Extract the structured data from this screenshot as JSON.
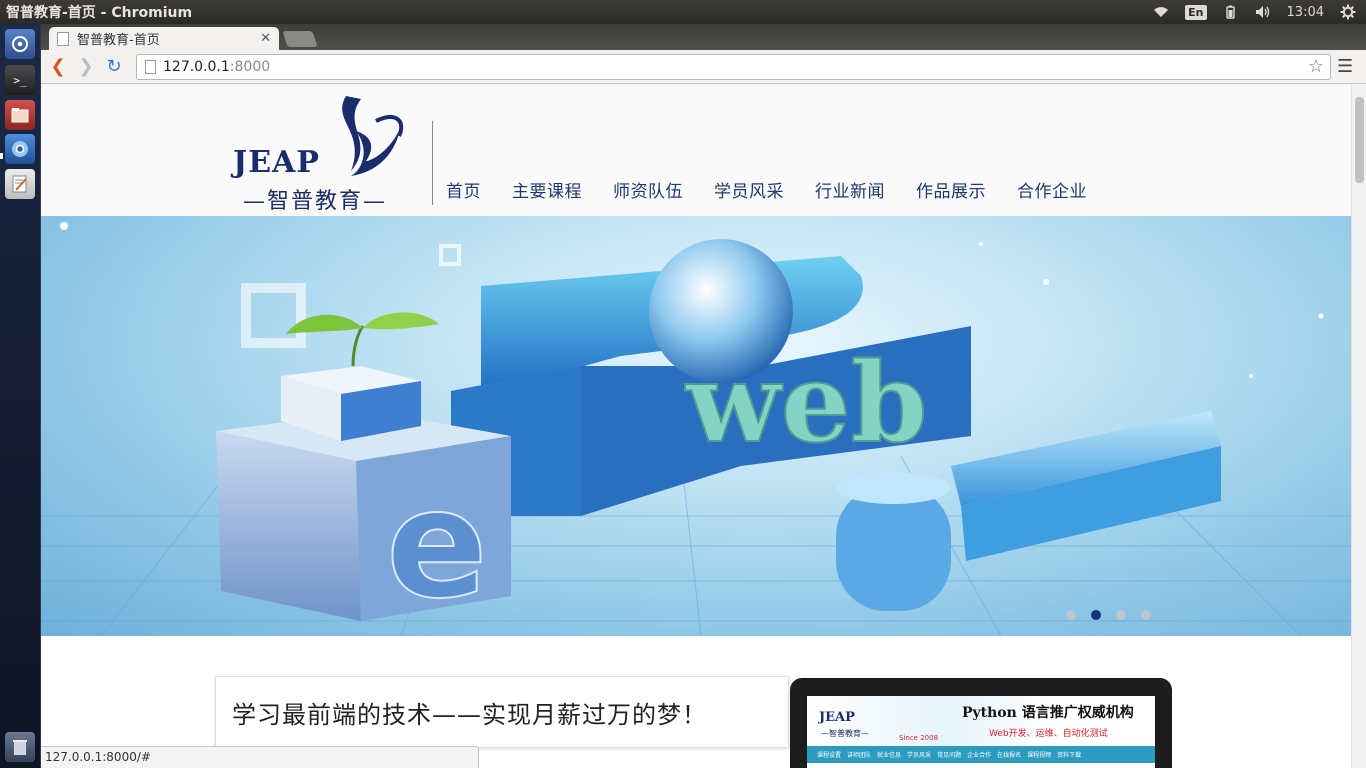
{
  "os": {
    "window_title": "智普教育-首页 - Chromium",
    "keyboard_layout": "En",
    "clock": "13:04"
  },
  "browser": {
    "tab_title": "智普教育-首页",
    "url_host": "127.0.0.1",
    "url_port": ":8000",
    "status_url": "127.0.0.1:8000/#"
  },
  "site": {
    "logo_en": "JEAP",
    "logo_cn": "—智普教育—",
    "nav": [
      "首页",
      "主要课程",
      "师资队伍",
      "学员风采",
      "行业新闻",
      "作品展示",
      "合作企业"
    ],
    "banner": {
      "word": "web",
      "letter": "e",
      "slides": 4,
      "active_slide": 2
    },
    "intro_text": "学习最前端的技术——实现月薪过万的梦！",
    "preview": {
      "logo": "JEAP",
      "logo_cn": "—智普教育—",
      "since": "Since 2008",
      "headline": "Python 语言推广权威机构",
      "sub": "Web开发、运维、自动化测试",
      "menu": [
        "课程设置",
        "讲师团队",
        "就业信息",
        "学员风采",
        "常见问题",
        "企业合作",
        "在线报名",
        "课程视频",
        "资料下载"
      ]
    }
  },
  "colors": {
    "nav_text": "#1b3872",
    "logo": "#1a2c6b",
    "dot_active": "#14367a",
    "banner_blue": "#3a7fd0"
  }
}
